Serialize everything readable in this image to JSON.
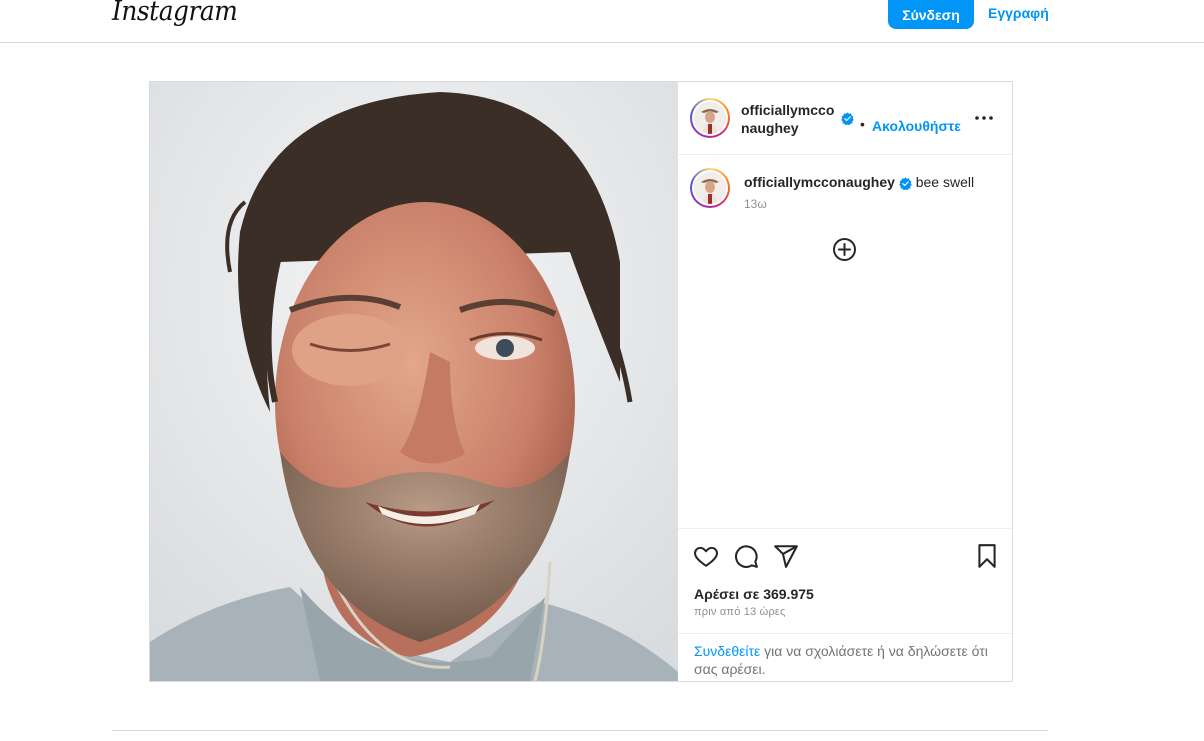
{
  "nav": {
    "logo": "Instagram",
    "login_label": "Σύνδεση",
    "signup_label": "Εγγραφή"
  },
  "post": {
    "username_line1": "officiallymccon",
    "username_line2": "aughey",
    "follow_label": "Ακολουθήστε",
    "separator": "•",
    "caption": {
      "username": "officiallymcconaughey",
      "text": "bee swell",
      "time": "13ω"
    },
    "likes": "Αρέσει σε 369.975",
    "time_ago": "πριν από 13 ώρες",
    "login_prompt": {
      "link": "Συνδεθείτε",
      "rest": " για να σχολιάσετε ή να δηλώσετε ότι σας αρέσει."
    }
  },
  "icons": {
    "more": "more-options-icon",
    "verified": "verified-badge-icon",
    "load_more": "add-circle-icon",
    "like": "heart-icon",
    "comment": "comment-icon",
    "share": "paper-plane-icon",
    "save": "bookmark-icon"
  },
  "colors": {
    "accent": "#0095f6",
    "text": "#262626",
    "secondary": "#8e8e8e",
    "border": "#dbdbdb"
  }
}
